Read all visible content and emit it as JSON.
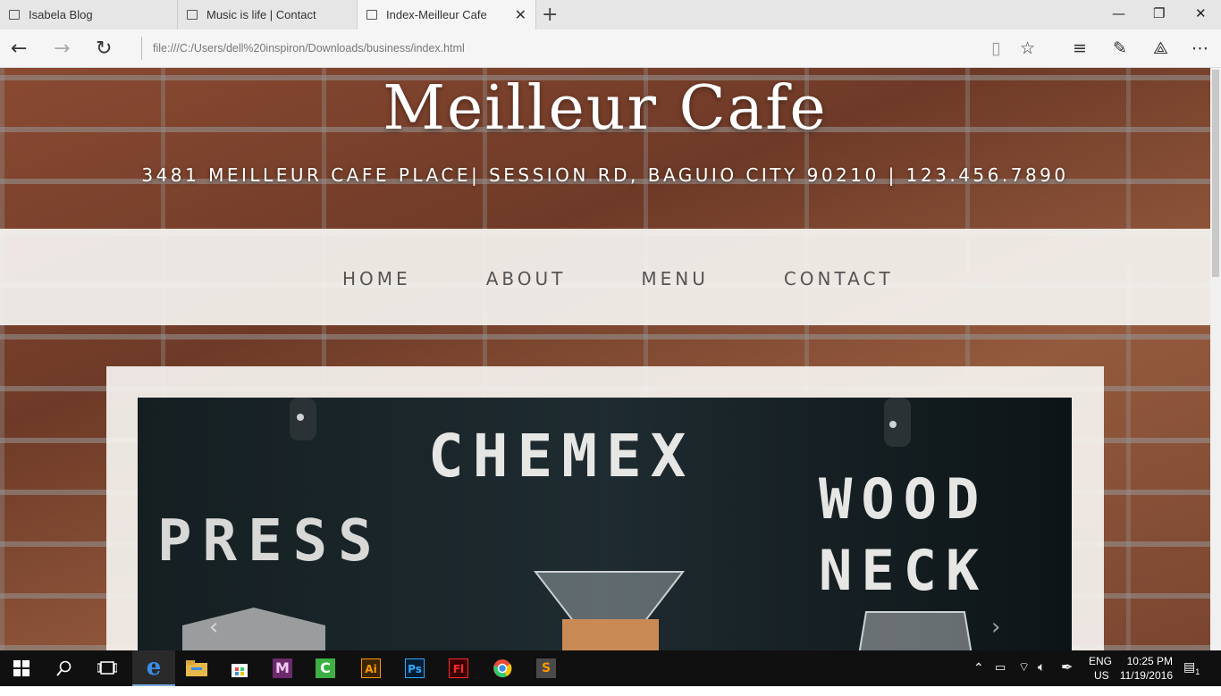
{
  "browser": {
    "tabs": [
      {
        "title": "Isabela Blog"
      },
      {
        "title": "Music is life | Contact"
      },
      {
        "title": "Index-Meilleur Cafe"
      }
    ],
    "url": "file:///C:/Users/dell%20inspiron/Downloads/business/index.html"
  },
  "site": {
    "title": "Meilleur Cafe",
    "address": "3481 MEILLEUR CAFE PLACE| SESSION RD, BAGUIO CITY 90210 | 123.456.7890",
    "nav": [
      "HOME",
      "ABOUT",
      "MENU",
      "CONTACT"
    ],
    "slide": {
      "words": [
        "CHEMEX",
        "PRESS",
        "WOOD",
        "NECK"
      ],
      "prev": "‹",
      "next": "›"
    }
  },
  "taskbar": {
    "lang_top": "ENG",
    "lang_bottom": "US",
    "time": "10:25 PM",
    "date": "11/19/2016",
    "notifications": "1"
  }
}
